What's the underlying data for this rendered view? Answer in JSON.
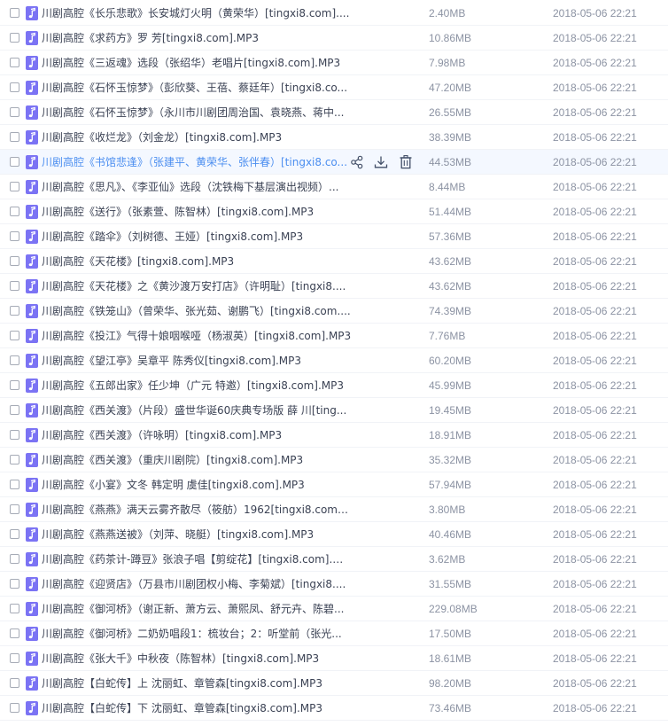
{
  "colors": {
    "icon_bg": "#7b73f4",
    "link_hover": "#4b8ef0",
    "meta_text": "#8c93a3",
    "name_text": "#3b4254"
  },
  "icons": {
    "file_type": "music-note-icon",
    "share": "share-icon",
    "download": "download-icon",
    "delete": "trash-icon"
  },
  "files": [
    {
      "name": "川剧高腔《长乐悲歌》长安城灯火明（黄荣华）[tingxi8.com]....",
      "size": "2.40MB",
      "date": "2018-05-06 22:21"
    },
    {
      "name": "川剧高腔《求药方》罗 芳[tingxi8.com].MP3",
      "size": "10.86MB",
      "date": "2018-05-06 22:21"
    },
    {
      "name": "川剧高腔《三返魂》选段（张绍华）老唱片[tingxi8.com].MP3",
      "size": "7.98MB",
      "date": "2018-05-06 22:21"
    },
    {
      "name": "川剧高腔《石怀玉惊梦》（彭欣葵、王蓓、蔡廷年）[tingxi8.co...",
      "size": "47.20MB",
      "date": "2018-05-06 22:21"
    },
    {
      "name": "川剧高腔《石怀玉惊梦》（永川市川剧团周治国、袁晓燕、蒋中...",
      "size": "26.55MB",
      "date": "2018-05-06 22:21"
    },
    {
      "name": "川剧高腔《收烂龙》（刘金龙）[tingxi8.com].MP3",
      "size": "38.39MB",
      "date": "2018-05-06 22:21"
    },
    {
      "name": "川剧高腔《书馆悲逢》（张建平、黄荣华、张伴春）[tingxi8.co...",
      "size": "44.53MB",
      "date": "2018-05-06 22:21",
      "hovered": true
    },
    {
      "name": "川剧高腔《思凡》、《李亚仙》选段（沈铁梅下基层演出视频）...",
      "size": "8.44MB",
      "date": "2018-05-06 22:21"
    },
    {
      "name": "川剧高腔《送行》（张素萱、陈智林）[tingxi8.com].MP3",
      "size": "51.44MB",
      "date": "2018-05-06 22:21"
    },
    {
      "name": "川剧高腔《踏伞》（刘树德、王娅）[tingxi8.com].MP3",
      "size": "57.36MB",
      "date": "2018-05-06 22:21"
    },
    {
      "name": "川剧高腔《天花楼》[tingxi8.com].MP3",
      "size": "43.62MB",
      "date": "2018-05-06 22:21"
    },
    {
      "name": "川剧高腔《天花楼》之《黄沙渡万安打店》（许明耻）[tingxi8....",
      "size": "43.62MB",
      "date": "2018-05-06 22:21"
    },
    {
      "name": "川剧高腔《铁笼山》（曾荣华、张光茹、谢鹏飞）[tingxi8.com....",
      "size": "74.39MB",
      "date": "2018-05-06 22:21"
    },
    {
      "name": "川剧高腔《投江》气得十娘咽喉哑（杨淑英）[tingxi8.com].MP3",
      "size": "7.76MB",
      "date": "2018-05-06 22:21"
    },
    {
      "name": "川剧高腔《望江亭》吴章平 陈秀仪[tingxi8.com].MP3",
      "size": "60.20MB",
      "date": "2018-05-06 22:21"
    },
    {
      "name": "川剧高腔《五郎出家》任少坤（广元 特邀）[tingxi8.com].MP3",
      "size": "45.99MB",
      "date": "2018-05-06 22:21"
    },
    {
      "name": "川剧高腔《西关渡》（片段）盛世华诞60庆典专场版 薛 川[ting...",
      "size": "19.45MB",
      "date": "2018-05-06 22:21"
    },
    {
      "name": "川剧高腔《西关渡》（许咏明）[tingxi8.com].MP3",
      "size": "18.91MB",
      "date": "2018-05-06 22:21"
    },
    {
      "name": "川剧高腔《西关渡》（重庆川剧院）[tingxi8.com].MP3",
      "size": "35.32MB",
      "date": "2018-05-06 22:21"
    },
    {
      "name": "川剧高腔《小宴》文冬 韩定明 虞佳[tingxi8.com].MP3",
      "size": "57.94MB",
      "date": "2018-05-06 22:21"
    },
    {
      "name": "川剧高腔《燕燕》满天云雾齐散尽（筱舫）1962[tingxi8.com]....",
      "size": "3.80MB",
      "date": "2018-05-06 22:21"
    },
    {
      "name": "川剧高腔《燕燕送被》（刘萍、晓艇）[tingxi8.com].MP3",
      "size": "40.46MB",
      "date": "2018-05-06 22:21"
    },
    {
      "name": "川剧高腔《药茶计-蹲豆》张浪子唱【剪绽花】[tingxi8.com].M...",
      "size": "3.62MB",
      "date": "2018-05-06 22:21"
    },
    {
      "name": "川剧高腔《迎贤店》（万县市川剧团权小梅、李菊斌）[tingxi8....",
      "size": "31.55MB",
      "date": "2018-05-06 22:21"
    },
    {
      "name": "川剧高腔《御河桥》（谢正新、萧方云、萧熙凤、舒元卉、陈碧...",
      "size": "229.08MB",
      "date": "2018-05-06 22:21"
    },
    {
      "name": "川剧高腔《御河桥》二奶奶唱段1：梳妆台；2：听堂前（张光...",
      "size": "17.50MB",
      "date": "2018-05-06 22:21"
    },
    {
      "name": "川剧高腔《张大千》中秋夜（陈智林）[tingxi8.com].MP3",
      "size": "18.61MB",
      "date": "2018-05-06 22:21"
    },
    {
      "name": "川剧高腔【白蛇传】上 沈丽虹、章管森[tingxi8.com].MP3",
      "size": "98.20MB",
      "date": "2018-05-06 22:21"
    },
    {
      "name": "川剧高腔【白蛇传】下 沈丽虹、章管森[tingxi8.com].MP3",
      "size": "73.46MB",
      "date": "2018-05-06 22:21"
    }
  ]
}
